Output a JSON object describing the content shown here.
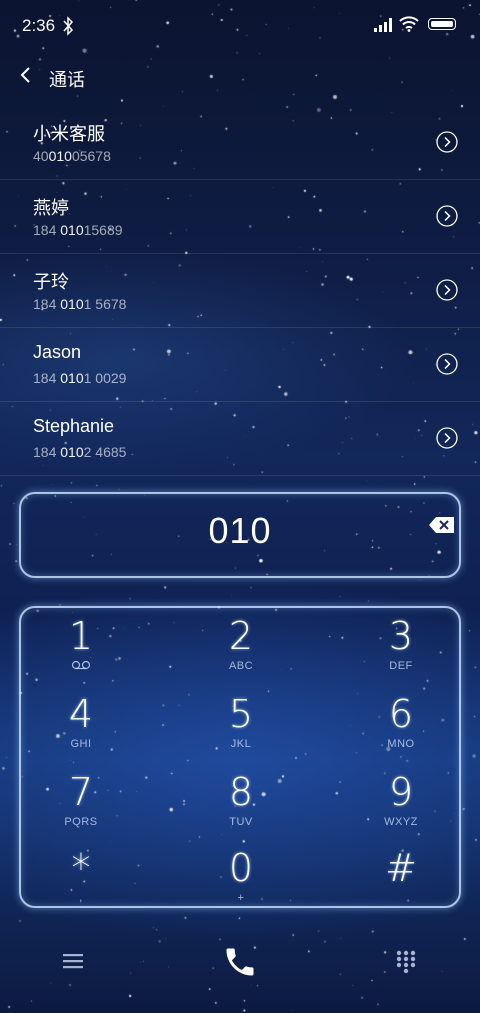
{
  "status_bar": {
    "time": "2:36"
  },
  "header": {
    "title": "通话"
  },
  "contacts": [
    {
      "name": "小米客服",
      "number_pre": "40",
      "number_match": "010",
      "number_post": "05678"
    },
    {
      "name": "燕婷",
      "number_pre": "184 ",
      "number_match": "010",
      "number_post": "15689"
    },
    {
      "name": "子玲",
      "number_pre": "184 ",
      "number_match": "010",
      "number_post": "1 5678"
    },
    {
      "name": "Jason",
      "number_pre": "184 ",
      "number_match": "010",
      "number_post": "1 0029"
    },
    {
      "name": "Stephanie",
      "number_pre": "184 ",
      "number_match": "010",
      "number_post": "2 4685"
    }
  ],
  "dial_input": {
    "value": "010"
  },
  "keypad": [
    {
      "digit": "1",
      "letters": ""
    },
    {
      "digit": "2",
      "letters": "ABC"
    },
    {
      "digit": "3",
      "letters": "DEF"
    },
    {
      "digit": "4",
      "letters": "GHI"
    },
    {
      "digit": "5",
      "letters": "JKL"
    },
    {
      "digit": "6",
      "letters": "MNO"
    },
    {
      "digit": "7",
      "letters": "PQRS"
    },
    {
      "digit": "8",
      "letters": "TUV"
    },
    {
      "digit": "9",
      "letters": "WXYZ"
    },
    {
      "digit": "*",
      "letters": ","
    },
    {
      "digit": "0",
      "letters": "+"
    },
    {
      "digit": "#",
      "letters": ""
    }
  ],
  "icons": {
    "back": "chevron-left-icon",
    "detail": "chevron-right-circle-icon",
    "delete": "backspace-icon",
    "menu": "menu-icon",
    "call": "phone-icon",
    "dialpad": "dialpad-icon",
    "voicemail": "voicemail-icon"
  },
  "colors": {
    "frame_glow": "#c8e1ff",
    "text": "#ffffff"
  }
}
